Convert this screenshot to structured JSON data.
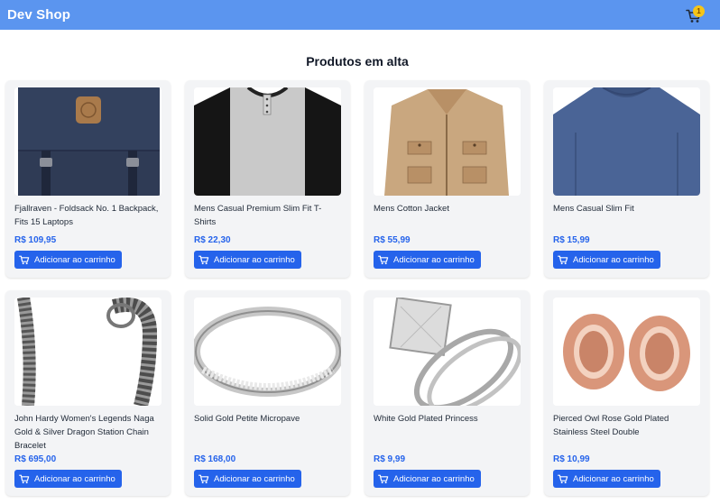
{
  "header": {
    "brand": "Dev Shop",
    "cart_count": "1",
    "cart_icon": "cart-icon"
  },
  "section_title": "Produtos em alta",
  "add_to_cart_label": "Adicionar ao carrinho",
  "colors": {
    "topbar": "#5b95ef",
    "accent": "#2563eb",
    "card": "#f3f4f6",
    "badge": "#f5c518"
  },
  "products": [
    {
      "title": "Fjallraven - Foldsack No. 1 Backpack, Fits 15 Laptops",
      "price": "R$ 109,95",
      "image": "backpack"
    },
    {
      "title": "Mens Casual Premium Slim Fit T-Shirts",
      "price": "R$ 22,30",
      "image": "tshirt"
    },
    {
      "title": "Mens Cotton Jacket",
      "price": "R$ 55,99",
      "image": "jacket"
    },
    {
      "title": "Mens Casual Slim Fit",
      "price": "R$ 15,99",
      "image": "longsleeve"
    },
    {
      "title": "John Hardy Women's Legends Naga Gold & Silver Dragon Station Chain Bracelet",
      "price": "R$ 695,00",
      "image": "bracelet"
    },
    {
      "title": "Solid Gold Petite Micropave",
      "price": "R$ 168,00",
      "image": "ring"
    },
    {
      "title": "White Gold Plated Princess",
      "price": "R$ 9,99",
      "image": "princess-ring"
    },
    {
      "title": "Pierced Owl Rose Gold Plated Stainless Steel Double",
      "price": "R$ 10,99",
      "image": "plugs"
    }
  ]
}
